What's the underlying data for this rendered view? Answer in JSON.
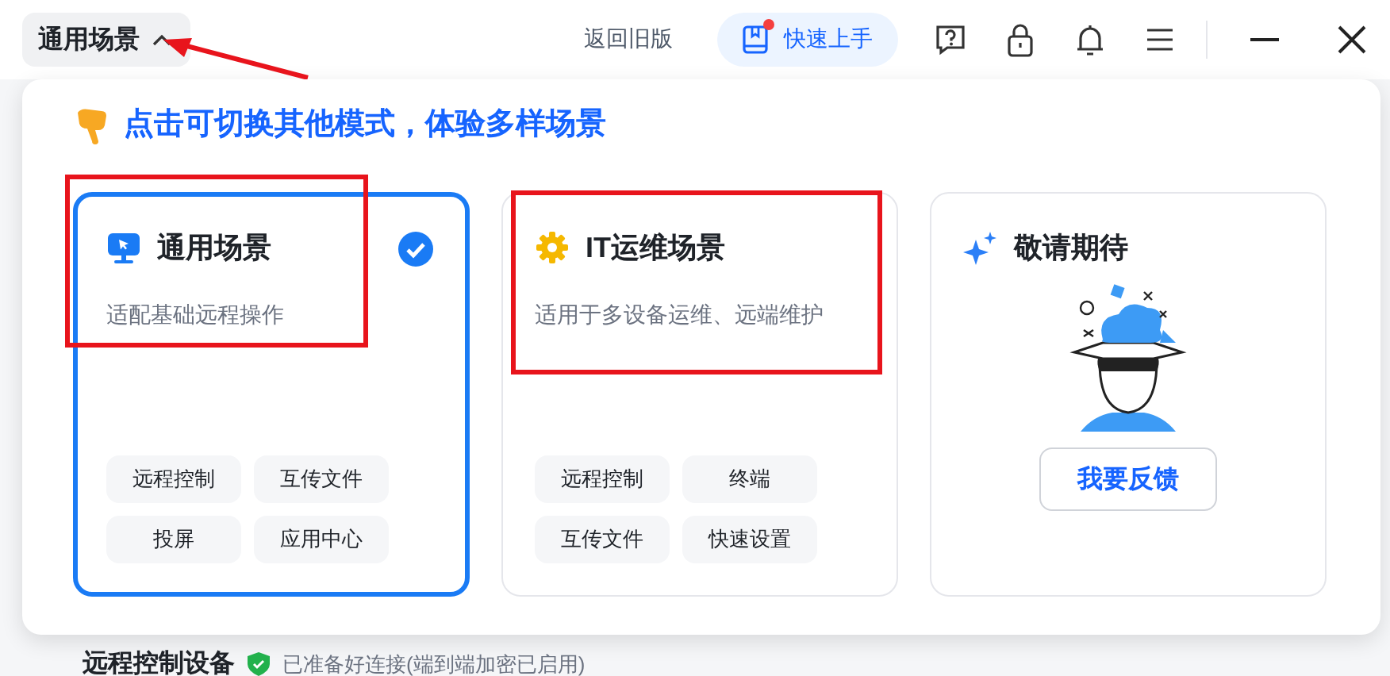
{
  "mode_button": {
    "label": "通用场景",
    "expanded": true
  },
  "toolbar": {
    "back_link": "返回旧版",
    "quick_start": {
      "label": "快速上手",
      "badge": true
    }
  },
  "panel": {
    "heading": "点击可切换其他模式，体验多样场景",
    "cards": [
      {
        "kind": "mode",
        "title": "通用场景",
        "description": "适配基础远程操作",
        "selected": true,
        "features": [
          "远程控制",
          "互传文件",
          "投屏",
          "应用中心"
        ]
      },
      {
        "kind": "mode",
        "title": "IT运维场景",
        "description": "适用于多设备运维、远端维护",
        "selected": false,
        "features": [
          "远程控制",
          "终端",
          "互传文件",
          "快速设置"
        ]
      },
      {
        "kind": "coming",
        "title": "敬请期待",
        "button": "我要反馈"
      }
    ]
  },
  "section": {
    "title": "远程控制设备",
    "status": "已准备好连接(端到端加密已启用)"
  }
}
